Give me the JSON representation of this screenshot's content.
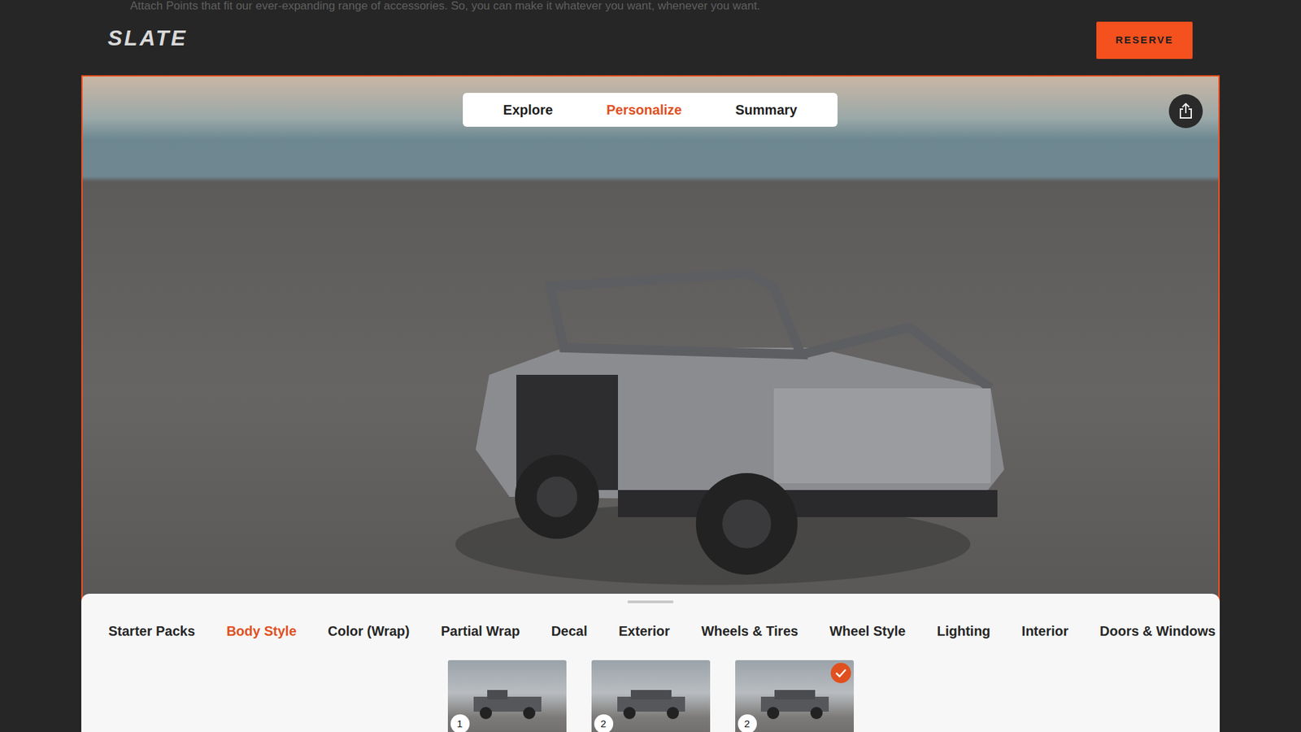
{
  "top_text": "Attach Points that fit our ever-expanding range of accessories. So, you can make it whatever you want, whenever you want.",
  "logo": "SLATE",
  "reserve_button": "RESERVE",
  "view_tabs": [
    {
      "label": "Explore",
      "selected": false
    },
    {
      "label": "Personalize",
      "selected": true
    },
    {
      "label": "Summary",
      "selected": false
    }
  ],
  "category_tabs": [
    {
      "label": "Starter Packs",
      "selected": false
    },
    {
      "label": "Body Style",
      "selected": true
    },
    {
      "label": "Color (Wrap)",
      "selected": false
    },
    {
      "label": "Partial Wrap",
      "selected": false
    },
    {
      "label": "Decal",
      "selected": false
    },
    {
      "label": "Exterior",
      "selected": false
    },
    {
      "label": "Wheels & Tires",
      "selected": false
    },
    {
      "label": "Wheel Style",
      "selected": false
    },
    {
      "label": "Lighting",
      "selected": false
    },
    {
      "label": "Interior",
      "selected": false
    },
    {
      "label": "Doors & Windows",
      "selected": false
    }
  ],
  "body_styles": [
    {
      "number": "1",
      "selected": false
    },
    {
      "number": "2",
      "selected": false
    },
    {
      "number": "2",
      "selected": true
    }
  ]
}
